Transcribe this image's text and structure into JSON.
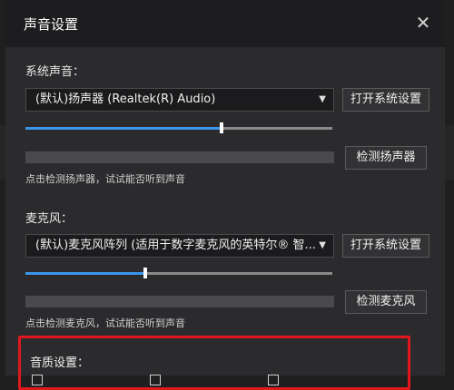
{
  "dialog": {
    "title": "声音设置",
    "close_glyph": "✕"
  },
  "system_sound": {
    "label": "系统声音：",
    "device": "(默认)扬声器 (Realtek(R) Audio)",
    "open_settings": "打开系统设置",
    "volume": 0.64,
    "test_button": "检测扬声器",
    "hint": "点击检测扬声器，试试能否听到声音"
  },
  "microphone": {
    "label": "麦克风：",
    "device": "(默认)麦克风阵列 (适用于数字麦克风的英特尔® 智...",
    "open_settings": "打开系统设置",
    "volume": 0.39,
    "test_button": "检测麦克风",
    "hint": "点击检测麦克风，试试能否听到声音"
  },
  "quality": {
    "label": "音质设置："
  },
  "colors": {
    "accent": "#3a96e8",
    "highlight_border": "#e0181e"
  }
}
